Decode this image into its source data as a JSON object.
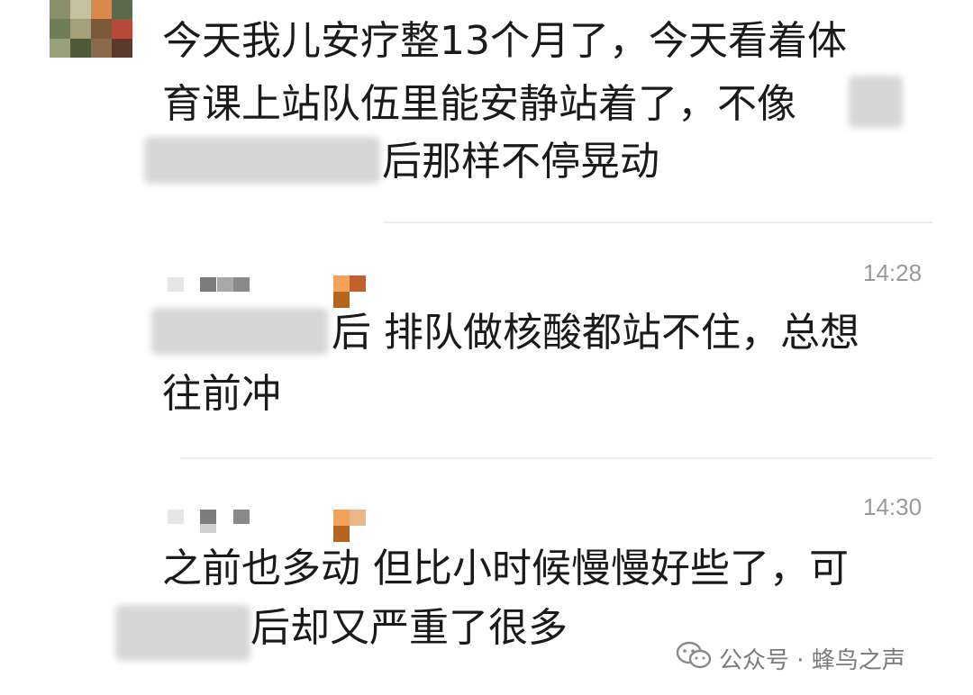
{
  "comments": [
    {
      "lines": [
        "今天我儿安疗整13个月了，今天看着体",
        "育课上站队伍里能安静站着了，不像",
        "后那样不停晃动"
      ],
      "time": ""
    },
    {
      "lines": [
        "后 排队做核酸都站不住，总想",
        "往前冲"
      ],
      "time": "14:28"
    },
    {
      "lines": [
        "之前也多动 但比小时候慢慢好些了，可",
        "后却又严重了很多"
      ],
      "time": "14:30"
    }
  ],
  "watermark": {
    "icon": "wechat-icon",
    "text": "公众号 · 蜂鸟之声"
  },
  "colors": {
    "text": "#1a1a1a",
    "time": "#9a9a9a",
    "divider": "#ececec",
    "blur": "#d6d6d6",
    "pixel_orange": "#f2a35a",
    "pixel_brown": "#b5651d"
  }
}
